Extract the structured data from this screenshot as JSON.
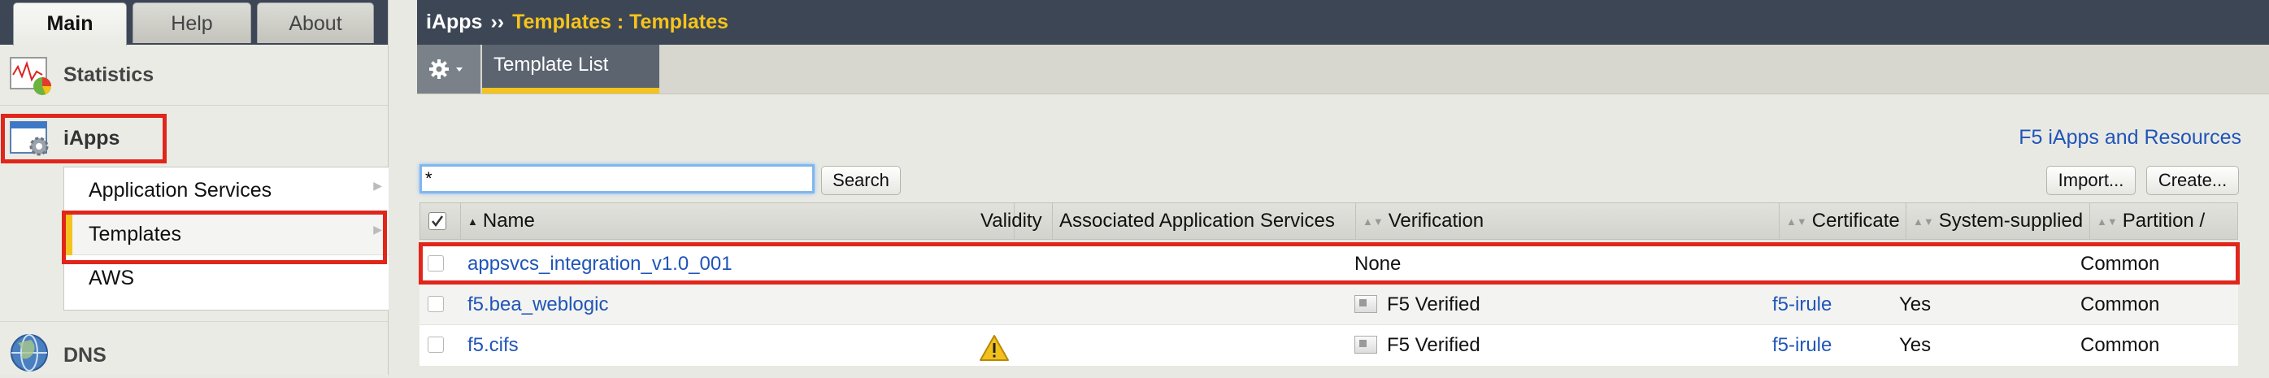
{
  "left_tabs": [
    {
      "label": "Main",
      "active": true
    },
    {
      "label": "Help",
      "active": false
    },
    {
      "label": "About",
      "active": false
    }
  ],
  "nav": {
    "statistics": {
      "label": "Statistics",
      "icon": "statistics-chart-icon"
    },
    "iapps": {
      "label": "iApps",
      "icon": "iapps-gear-window-icon"
    },
    "sub_items": [
      {
        "label": "Application Services",
        "selected": false
      },
      {
        "label": "Templates",
        "selected": true
      },
      {
        "label": "AWS",
        "selected": false
      }
    ],
    "dns": {
      "label": "DNS",
      "icon": "dns-globe-icon"
    }
  },
  "breadcrumb": {
    "root": "iApps",
    "separator": "››",
    "current": "Templates : Templates"
  },
  "toolbar": {
    "tab_label": "Template List"
  },
  "resources_link": "F5 iApps and Resources",
  "search": {
    "value": "*",
    "button": "Search"
  },
  "actions": {
    "import": "Import...",
    "create": "Create..."
  },
  "table": {
    "columns": [
      "Name",
      "Validity",
      "Associated Application Services",
      "Verification",
      "Certificate",
      "System-supplied",
      "Partition / Path"
    ],
    "rows": [
      {
        "name": "appsvcs_integration_v1.0_001",
        "validity": "",
        "associated": "",
        "verification": "None",
        "verified_icon": false,
        "certificate": "",
        "system_supplied": "",
        "partition": "Common",
        "highlighted": true
      },
      {
        "name": "f5.bea_weblogic",
        "validity": "",
        "associated": "",
        "verification": "F5 Verified",
        "verified_icon": true,
        "certificate": "f5-irule",
        "system_supplied": "Yes",
        "partition": "Common",
        "highlighted": false
      },
      {
        "name": "f5.cifs",
        "validity": "warning",
        "associated": "",
        "verification": "F5 Verified",
        "verified_icon": true,
        "certificate": "f5-irule",
        "system_supplied": "Yes",
        "partition": "Common",
        "highlighted": false
      }
    ]
  },
  "colors": {
    "highlight_red": "#e0261b",
    "accent_yellow": "#f5c31d",
    "link_blue": "#1f55b8",
    "header_dark": "#3c4654"
  }
}
